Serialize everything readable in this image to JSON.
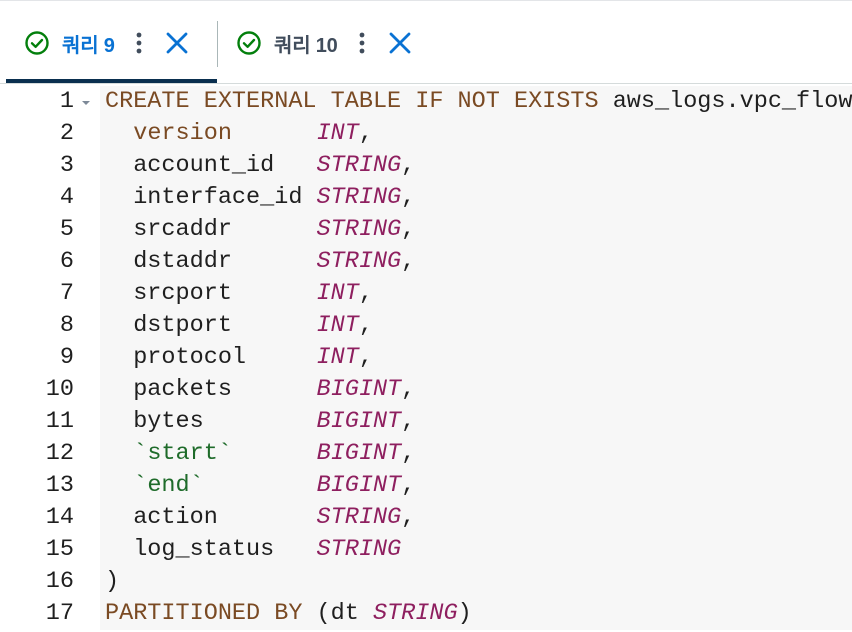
{
  "tabs": [
    {
      "label": "쿼리 9",
      "active": true,
      "status_icon": "check-circle-icon",
      "menu_icon": "kebab-icon",
      "close_icon": "close-icon"
    },
    {
      "label": "쿼리 10",
      "active": false,
      "status_icon": "check-circle-icon",
      "menu_icon": "kebab-icon",
      "close_icon": "close-icon"
    }
  ],
  "colors": {
    "active_tab_text": "#0972d3",
    "inactive_tab_text": "#414d5c",
    "success_icon": "#037f0c",
    "close_icon": "#0972d3",
    "keyword": "#7a4a23",
    "type": "#8e1f5f",
    "string": "#1e6b2a"
  },
  "editor": {
    "lines": [
      {
        "n": "1",
        "tokens": [
          {
            "t": "CREATE EXTERNAL TABLE IF NOT EXISTS",
            "c": "kw"
          },
          {
            "t": " aws_logs.vpc_flow (",
            "c": "id"
          }
        ]
      },
      {
        "n": "2",
        "tokens": [
          {
            "t": "  "
          },
          {
            "t": "version",
            "c": "kw"
          },
          {
            "t": "      "
          },
          {
            "t": "INT",
            "c": "tp"
          },
          {
            "t": ",",
            "c": "pn"
          }
        ]
      },
      {
        "n": "3",
        "tokens": [
          {
            "t": "  account_id   ",
            "c": "id"
          },
          {
            "t": "STRING",
            "c": "tp"
          },
          {
            "t": ",",
            "c": "pn"
          }
        ]
      },
      {
        "n": "4",
        "tokens": [
          {
            "t": "  interface_id ",
            "c": "id"
          },
          {
            "t": "STRING",
            "c": "tp"
          },
          {
            "t": ",",
            "c": "pn"
          }
        ]
      },
      {
        "n": "5",
        "tokens": [
          {
            "t": "  srcaddr      ",
            "c": "id"
          },
          {
            "t": "STRING",
            "c": "tp"
          },
          {
            "t": ",",
            "c": "pn"
          }
        ]
      },
      {
        "n": "6",
        "tokens": [
          {
            "t": "  dstaddr      ",
            "c": "id"
          },
          {
            "t": "STRING",
            "c": "tp"
          },
          {
            "t": ",",
            "c": "pn"
          }
        ]
      },
      {
        "n": "7",
        "tokens": [
          {
            "t": "  srcport      ",
            "c": "id"
          },
          {
            "t": "INT",
            "c": "tp"
          },
          {
            "t": ",",
            "c": "pn"
          }
        ]
      },
      {
        "n": "8",
        "tokens": [
          {
            "t": "  dstport      ",
            "c": "id"
          },
          {
            "t": "INT",
            "c": "tp"
          },
          {
            "t": ",",
            "c": "pn"
          }
        ]
      },
      {
        "n": "9",
        "tokens": [
          {
            "t": "  protocol     ",
            "c": "id"
          },
          {
            "t": "INT",
            "c": "tp"
          },
          {
            "t": ",",
            "c": "pn"
          }
        ]
      },
      {
        "n": "10",
        "tokens": [
          {
            "t": "  packets      ",
            "c": "id"
          },
          {
            "t": "BIGINT",
            "c": "tp"
          },
          {
            "t": ",",
            "c": "pn"
          }
        ]
      },
      {
        "n": "11",
        "tokens": [
          {
            "t": "  bytes        ",
            "c": "id"
          },
          {
            "t": "BIGINT",
            "c": "tp"
          },
          {
            "t": ",",
            "c": "pn"
          }
        ]
      },
      {
        "n": "12",
        "tokens": [
          {
            "t": "  "
          },
          {
            "t": "`start`",
            "c": "st"
          },
          {
            "t": "      "
          },
          {
            "t": "BIGINT",
            "c": "tp"
          },
          {
            "t": ",",
            "c": "pn"
          }
        ]
      },
      {
        "n": "13",
        "tokens": [
          {
            "t": "  "
          },
          {
            "t": "`end`",
            "c": "st"
          },
          {
            "t": "        "
          },
          {
            "t": "BIGINT",
            "c": "tp"
          },
          {
            "t": ",",
            "c": "pn"
          }
        ]
      },
      {
        "n": "14",
        "tokens": [
          {
            "t": "  action       ",
            "c": "id"
          },
          {
            "t": "STRING",
            "c": "tp"
          },
          {
            "t": ",",
            "c": "pn"
          }
        ]
      },
      {
        "n": "15",
        "tokens": [
          {
            "t": "  log_status   ",
            "c": "id"
          },
          {
            "t": "STRING",
            "c": "tp"
          }
        ]
      },
      {
        "n": "16",
        "tokens": [
          {
            "t": ")",
            "c": "pn"
          }
        ]
      },
      {
        "n": "17",
        "tokens": [
          {
            "t": "PARTITIONED BY",
            "c": "kw"
          },
          {
            "t": " (dt ",
            "c": "pn"
          },
          {
            "t": "STRING",
            "c": "tp"
          },
          {
            "t": ")",
            "c": "pn"
          }
        ]
      }
    ]
  }
}
